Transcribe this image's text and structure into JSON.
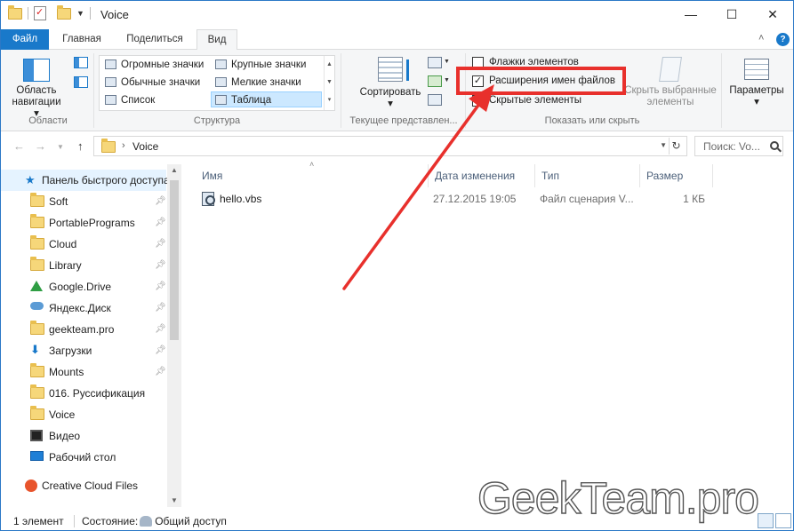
{
  "window": {
    "title": "Voice",
    "controls": {
      "minimize": "—",
      "maximize": "☐",
      "close": "✕"
    }
  },
  "ribbon_tabs": [
    {
      "label": "Файл"
    },
    {
      "label": "Главная"
    },
    {
      "label": "Поделиться"
    },
    {
      "label": "Вид"
    }
  ],
  "ribbon": {
    "panes_group": {
      "label": "Области",
      "nav_button": "Область\nнавигации ▾"
    },
    "layout_group": {
      "label": "Структура",
      "options": [
        "Огромные значки",
        "Крупные значки",
        "Обычные значки",
        "Мелкие значки",
        "Список",
        "Таблица"
      ],
      "selected": "Таблица"
    },
    "current_view_group": {
      "label": "Текущее представлен...",
      "sort_button": "Сортировать\n▾"
    },
    "show_hide_group": {
      "label": "Показать или скрыть",
      "checkboxes": [
        {
          "label": "Флажки элементов",
          "checked": false
        },
        {
          "label": "Расширения имен файлов",
          "checked": true
        },
        {
          "label": "Скрытые элементы",
          "checked": true
        }
      ],
      "hide_selected": "Скрыть выбранные\nэлементы"
    },
    "options_button": "Параметры\n▾"
  },
  "address": {
    "path": "Voice",
    "search_placeholder": "Поиск: Vo..."
  },
  "sidebar": {
    "quick_access": "Панель быстрого доступа",
    "items": [
      {
        "label": "Soft",
        "icon": "folder-icon",
        "pinned": true
      },
      {
        "label": "PortablePrograms",
        "icon": "folder-icon",
        "pinned": true
      },
      {
        "label": "Cloud",
        "icon": "folder-icon",
        "pinned": true
      },
      {
        "label": "Library",
        "icon": "folder-icon",
        "pinned": true
      },
      {
        "label": "Google.Drive",
        "icon": "google-drive-icon",
        "pinned": true
      },
      {
        "label": "Яндекс.Диск",
        "icon": "yandex-disk-icon",
        "pinned": true
      },
      {
        "label": "geekteam.pro",
        "icon": "folder-icon",
        "pinned": true
      },
      {
        "label": "Загрузки",
        "icon": "downloads-icon",
        "pinned": true
      },
      {
        "label": "Mounts",
        "icon": "folder-icon",
        "pinned": true
      },
      {
        "label": "016. Руссификация",
        "icon": "folder-icon",
        "pinned": false
      },
      {
        "label": "Voice",
        "icon": "folder-icon",
        "pinned": false
      },
      {
        "label": "Видео",
        "icon": "video-icon",
        "pinned": false
      },
      {
        "label": "Рабочий стол",
        "icon": "desktop-icon",
        "pinned": false
      }
    ],
    "creative_cloud": "Creative Cloud Files"
  },
  "file_list": {
    "columns": [
      "Имя",
      "Дата изменения",
      "Тип",
      "Размер"
    ],
    "rows": [
      {
        "name": "hello.vbs",
        "date": "27.12.2015 19:05",
        "type": "Файл сценария V...",
        "size": "1 КБ"
      }
    ]
  },
  "status": {
    "count": "1 элемент",
    "state_label": "Состояние:",
    "state_value": "Общий доступ"
  },
  "watermark": "GeekTeam.pro",
  "colors": {
    "accent": "#1979ca",
    "highlight": "#e8302c",
    "selection": "#cce8ff"
  }
}
